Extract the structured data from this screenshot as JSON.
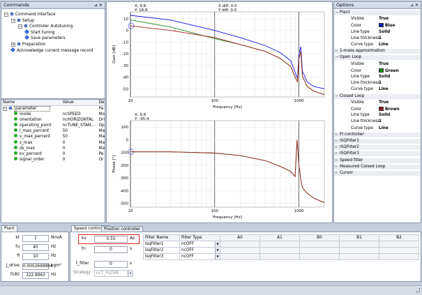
{
  "commands": {
    "title": "Commands",
    "pin": "⊿ ✕",
    "tree": [
      {
        "label": "Command Interface",
        "level": 0,
        "icon": "gear",
        "exp": "−"
      },
      {
        "label": "Setup",
        "level": 1,
        "icon": "gear",
        "exp": "−"
      },
      {
        "label": "Controller Autotuning",
        "level": 2,
        "icon": "gear",
        "exp": "−"
      },
      {
        "label": "Start tuning",
        "level": 3,
        "icon": "diamond"
      },
      {
        "label": "Save parameters",
        "level": 3,
        "icon": "diamond"
      },
      {
        "label": "Preparation",
        "level": 1,
        "icon": "gear",
        "exp": "+"
      },
      {
        "label": "Acknowledge current message record",
        "level": 1,
        "icon": "diamond"
      }
    ]
  },
  "params": {
    "headers": [
      "Name",
      "Value",
      "De"
    ],
    "root": "parameter",
    "root_desc": "Pa",
    "rows": [
      {
        "name": "mode",
        "value": "ncSPEED",
        "desc": "Mo"
      },
      {
        "name": "orientation",
        "value": "ncHORIZONTAL",
        "desc": "Ori"
      },
      {
        "name": "operating_point",
        "value": "ncTUNE_STAN...",
        "desc": "Op"
      },
      {
        "name": "i_max_percent",
        "value": "50",
        "desc": "Ma"
      },
      {
        "name": "v_max_percent",
        "value": "50",
        "desc": "Ma"
      },
      {
        "name": "s_max",
        "value": "0",
        "desc": "Ma"
      },
      {
        "name": "ds_max",
        "value": "0",
        "desc": "Ma"
      },
      {
        "name": "kv_percent",
        "value": "0",
        "desc": "Pe"
      },
      {
        "name": "signal_order",
        "value": "0",
        "desc": "Or"
      }
    ]
  },
  "gain_plot": {
    "cursor_x": "X: 9.8",
    "cursor_y": "Y: 16.8",
    "xdiff": "X diff: 0.0",
    "ydiff": "Y diff: 0.0",
    "ylabel": "Gain [dB]",
    "xlabel": "Frequency [Hz]",
    "yticks": [
      "10",
      "0",
      "-10",
      "-20",
      "-30",
      "-40",
      "-50"
    ],
    "xticks": [
      "10",
      "100",
      "1000"
    ]
  },
  "phase_plot": {
    "cursor_x": "X: 9.8",
    "cursor_y": "Y: -95.4",
    "ylabel": "Phase [°]",
    "xlabel": "Frequency [Hz]",
    "yticks": [
      "100",
      "0",
      "-100",
      "-200",
      "-300",
      "-400",
      "-500"
    ],
    "xticks": [
      "10",
      "100",
      "1000"
    ]
  },
  "chart_data": [
    {
      "type": "line",
      "xlabel": "Frequency [Hz]",
      "ylabel": "Gain [dB]",
      "xscale": "log",
      "xlim": [
        10,
        2000
      ],
      "ylim": [
        -57,
        16
      ],
      "series": [
        {
          "color": "#1010e0",
          "x": [
            10,
            30,
            100,
            200,
            400,
            600,
            800,
            900,
            960,
            1000,
            1050,
            1100,
            1250,
            1500,
            2000
          ],
          "y": [
            13,
            9,
            0,
            -6,
            -13,
            -19,
            -26,
            -36,
            -41,
            -20,
            -14,
            -35,
            -44,
            -48,
            -50
          ]
        },
        {
          "color": "#1a8a1a",
          "x": [
            10,
            30,
            100,
            200,
            400,
            600,
            800,
            900,
            960,
            1000,
            1050,
            1100,
            1250,
            1500,
            2000
          ],
          "y": [
            9,
            3,
            -7,
            -12,
            -18,
            -24,
            -31,
            -40,
            -44,
            -24,
            -18,
            -39,
            -48,
            -52,
            -55
          ]
        },
        {
          "color": "#a02020",
          "x": [
            10,
            30,
            100,
            200,
            400,
            600,
            800,
            900,
            960,
            1000,
            1050,
            1100,
            1250,
            1500,
            2000
          ],
          "y": [
            4,
            0,
            -6,
            -12,
            -18,
            -24,
            -31,
            -40,
            -44,
            -24,
            -18,
            -39,
            -48,
            -52,
            -55
          ]
        }
      ]
    },
    {
      "type": "line",
      "xlabel": "Frequency [Hz]",
      "ylabel": "Phase [°]",
      "xscale": "log",
      "xlim": [
        10,
        2000
      ],
      "ylim": [
        -530,
        150
      ],
      "series": [
        {
          "color": "#1a8a1a",
          "x": [
            10,
            30,
            100,
            200,
            400,
            600,
            800,
            900,
            950,
            1000,
            1050,
            1100,
            1250,
            1500,
            2000
          ],
          "y": [
            -95,
            -95,
            -105,
            -125,
            -165,
            -210,
            -250,
            -290,
            0,
            -200,
            -310,
            -380,
            -420,
            -460,
            -495
          ]
        },
        {
          "color": "#a02020",
          "x": [
            10,
            30,
            100,
            200,
            400,
            600,
            800,
            900,
            950,
            1000,
            1050,
            1100,
            1250,
            1500,
            2000
          ],
          "y": [
            -95,
            -95,
            -105,
            -125,
            -165,
            -210,
            -250,
            -290,
            0,
            -200,
            -310,
            -380,
            -420,
            -460,
            -495
          ]
        }
      ]
    }
  ],
  "options": {
    "title": "Options",
    "pin": "⊿ ✕",
    "rows": [
      {
        "kind": "sec",
        "label": "Plant",
        "exp": "−"
      },
      {
        "kind": "prop",
        "label": "Visible",
        "value": "True"
      },
      {
        "kind": "prop",
        "label": "Color",
        "value": "Blue",
        "swatch": "#0a23b8"
      },
      {
        "kind": "prop",
        "label": "Line type",
        "value": "Solid"
      },
      {
        "kind": "prop",
        "label": "Line thickness",
        "value": "1"
      },
      {
        "kind": "prop",
        "label": "Curve type",
        "value": "Line"
      },
      {
        "kind": "sec",
        "label": "1-mass approximation",
        "exp": "▹"
      },
      {
        "kind": "sec",
        "label": "Open Loop",
        "exp": "−"
      },
      {
        "kind": "prop",
        "label": "Visible",
        "value": "True"
      },
      {
        "kind": "prop",
        "label": "Color",
        "value": "Green",
        "swatch": "#138a13"
      },
      {
        "kind": "prop",
        "label": "Line type",
        "value": "Solid"
      },
      {
        "kind": "prop",
        "label": "Line thickness",
        "value": "1"
      },
      {
        "kind": "prop",
        "label": "Curve type",
        "value": "Line"
      },
      {
        "kind": "sec",
        "label": "Closed Loop",
        "exp": "−"
      },
      {
        "kind": "prop",
        "label": "Visible",
        "value": "True"
      },
      {
        "kind": "prop",
        "label": "Color",
        "value": "Brown",
        "swatch": "#8a1f1f"
      },
      {
        "kind": "prop",
        "label": "Line type",
        "value": "Solid"
      },
      {
        "kind": "prop",
        "label": "Line thickness",
        "value": "1"
      },
      {
        "kind": "prop",
        "label": "Curve type",
        "value": "Line"
      },
      {
        "kind": "sec",
        "label": "PI controller",
        "exp": "▹"
      },
      {
        "kind": "sec",
        "label": "ISQFilter1",
        "exp": "▹"
      },
      {
        "kind": "sec",
        "label": "ISQFilter2",
        "exp": "▹"
      },
      {
        "kind": "sec",
        "label": "ISQFilter3",
        "exp": "▹"
      },
      {
        "kind": "sec",
        "label": "Speed filter",
        "exp": "▹"
      },
      {
        "kind": "sec",
        "label": "Measured Closed Loop",
        "exp": "▹"
      },
      {
        "kind": "sec",
        "label": "Cursor",
        "exp": "▹"
      }
    ]
  },
  "plant": {
    "tab": "Plant",
    "rows": [
      {
        "label": "kt",
        "value": "1",
        "unit": "Nm/A"
      },
      {
        "label": "fu",
        "value": "40",
        "unit": "Hz"
      },
      {
        "label": "fi",
        "value": "10",
        "unit": "Hz"
      },
      {
        "label": "J_drive",
        "value": "0.0002699894",
        "unit": "kgm²"
      },
      {
        "label": "f180",
        "value": "322.8963",
        "unit": "Hz"
      }
    ]
  },
  "speed": {
    "tabs": [
      "Speed controller",
      "Position controller"
    ],
    "kv": {
      "label": "kv",
      "value": "0.55",
      "unit": "As"
    },
    "tn": {
      "label": "tn",
      "value": "0",
      "unit": "s"
    },
    "tfilter": {
      "label": "t_filter",
      "value": "0",
      "unit": "s"
    },
    "strategy": {
      "label": "Strategy",
      "value": "ncT_FILTER"
    },
    "filter_headers": [
      "Filter Name",
      "Filter Type",
      "A0",
      "A1",
      "B0",
      "B1",
      "B2"
    ],
    "filters": [
      {
        "name": "IsqFilter1",
        "type": "ncOFF"
      },
      {
        "name": "IsqFilter2",
        "type": "ncOFF"
      },
      {
        "name": "IsqFilter3",
        "type": "ncOFF"
      }
    ]
  }
}
